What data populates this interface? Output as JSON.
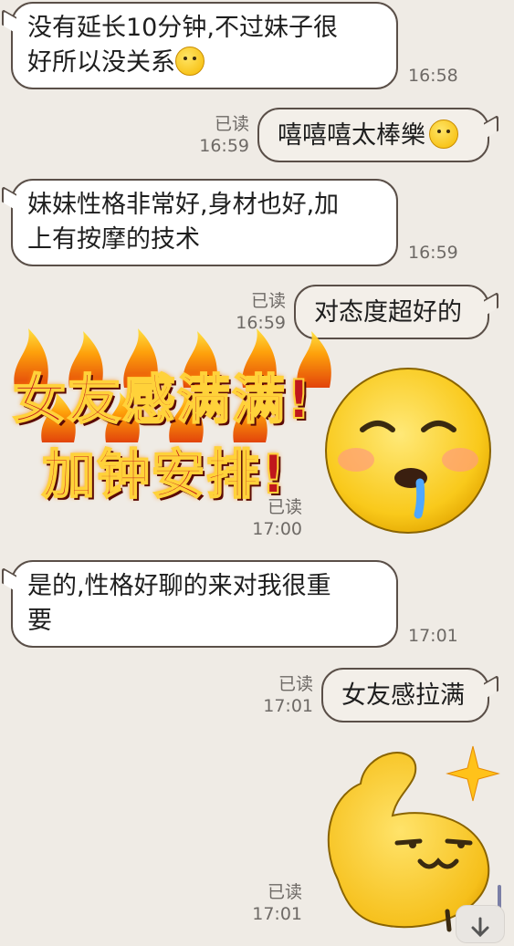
{
  "messages": [
    {
      "dir": "in",
      "line1": "没有延长10分钟,不过妹子很",
      "line2": "好所以没关系",
      "emoji": "thumbs-up-emoji",
      "time": "16:58"
    },
    {
      "dir": "out",
      "text": "嘻嘻嘻太棒樂",
      "emoji": "drooling-face-emoji",
      "read": "已读",
      "time": "16:59"
    },
    {
      "dir": "in",
      "line1": "妹妹性格非常好,身材也好,加",
      "line2": "上有按摩的技术",
      "time": "16:59"
    },
    {
      "dir": "out",
      "text": "对态度超好的",
      "read": "已读",
      "time": "16:59"
    },
    {
      "dir": "out",
      "sticker": "girlfriend-feeling-sticker",
      "sticker_line1": "女友感满满!",
      "sticker_line2": "加钟安排!",
      "read": "已读",
      "time": "17:00"
    },
    {
      "dir": "in",
      "line1": "是的,性格好聊的来对我很重",
      "line2": "要",
      "time": "17:01"
    },
    {
      "dir": "out",
      "text": "女友感拉满",
      "read": "已读",
      "time": "17:01"
    },
    {
      "dir": "out",
      "sticker": "flexing-emoji-sticker",
      "read": "已读",
      "time": "17:01"
    }
  ],
  "colors": {
    "background": "#efebe5",
    "bubble_border": "#5a4f48",
    "sticker_red": "#c0171c",
    "emoji_yellow": "#fcd535"
  }
}
